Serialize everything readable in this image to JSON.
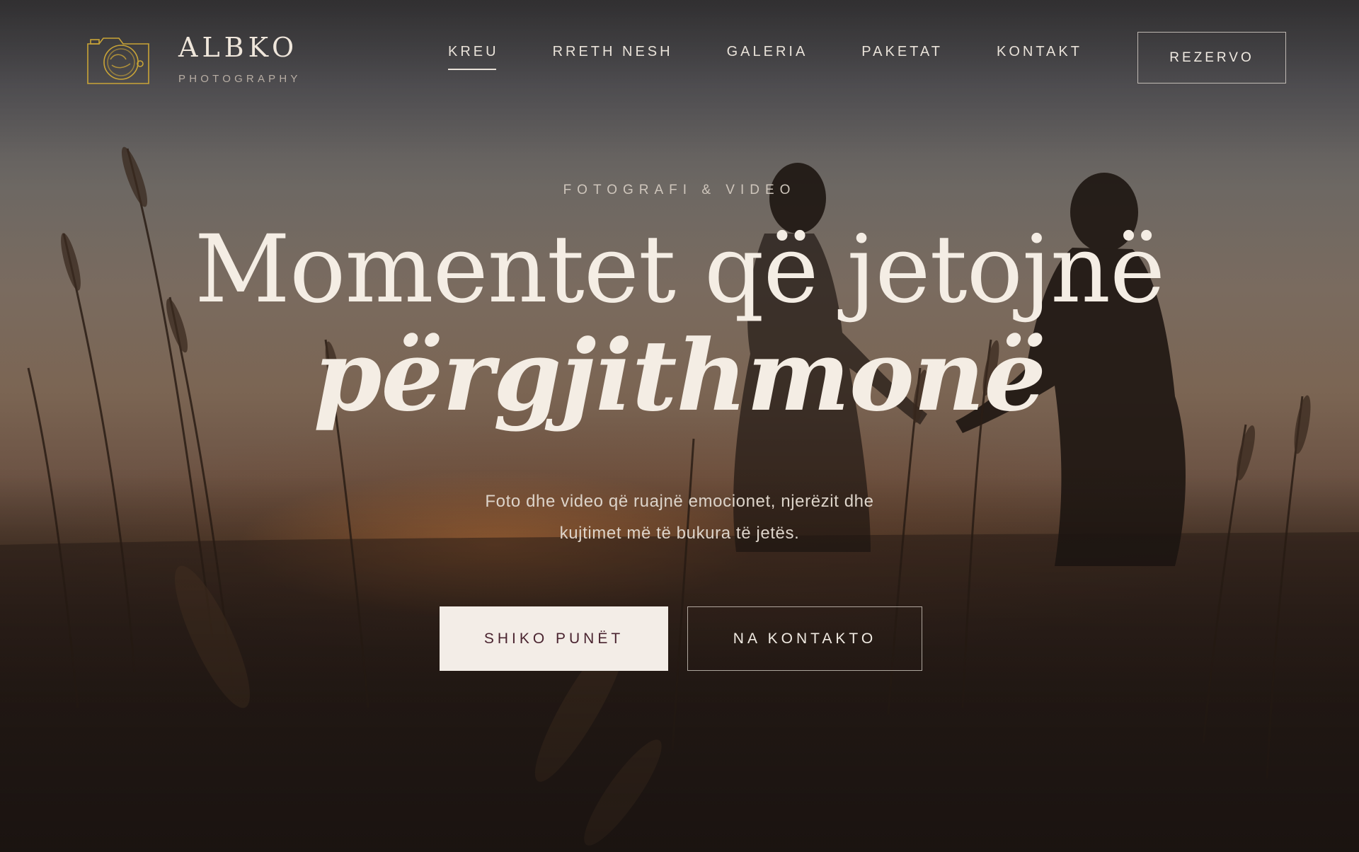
{
  "brand": {
    "name": "ALBKO",
    "subtitle": "PHOTOGRAPHY",
    "logo_icon": "camera-logo-icon",
    "accent_color": "#c9a437"
  },
  "nav": {
    "items": [
      {
        "label": "KREU",
        "active": true
      },
      {
        "label": "RRETH NESH",
        "active": false
      },
      {
        "label": "GALERIA",
        "active": false
      },
      {
        "label": "PAKETAT",
        "active": false
      },
      {
        "label": "KONTAKT",
        "active": false
      }
    ],
    "cta_label": "REZERVO"
  },
  "hero": {
    "eyebrow": "FOTOGRAFI & VIDEO",
    "title_line1": "Momentet që jetojnë",
    "title_line2": "përgjithmonë",
    "lead": "Foto dhe video që ruajnë emocionet, njerëzit dhe kujtimet më të bukura të jetës.",
    "primary_button": "SHIKO PUNËT",
    "secondary_button": "NA KONTAKTO"
  },
  "colors": {
    "text_light": "#f4ede4",
    "primary_button_bg": "#f3ede7",
    "primary_button_text": "#4a2430"
  }
}
